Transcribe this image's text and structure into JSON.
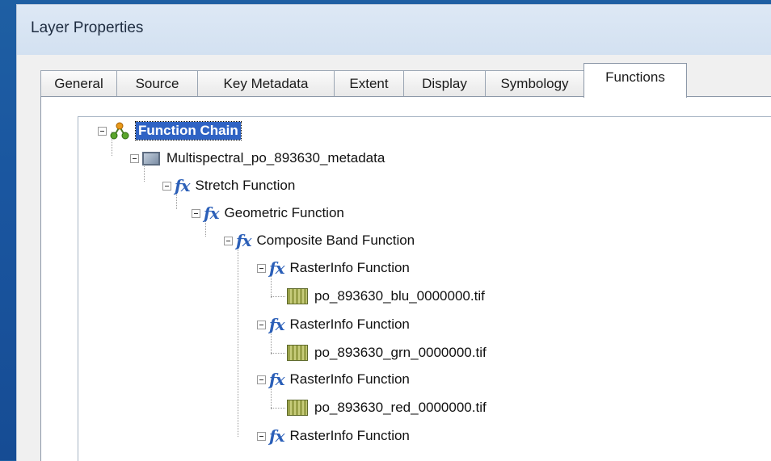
{
  "window": {
    "title": "Layer Properties"
  },
  "tabs": [
    {
      "label": "General"
    },
    {
      "label": "Source"
    },
    {
      "label": "Key Metadata"
    },
    {
      "label": "Extent"
    },
    {
      "label": "Display"
    },
    {
      "label": "Symbology"
    },
    {
      "label": "Functions"
    }
  ],
  "active_tab": "Functions",
  "tree": {
    "root": {
      "label": "Function Chain",
      "icon": "function-chain-icon"
    },
    "metadata": {
      "label": "Multispectral_po_893630_metadata",
      "icon": "raster-dataset-icon"
    },
    "stretch": {
      "label": "Stretch Function",
      "icon": "fx-icon"
    },
    "geometric": {
      "label": "Geometric Function",
      "icon": "fx-icon"
    },
    "composite": {
      "label": "Composite Band Function",
      "icon": "fx-icon"
    },
    "raster_info_1": {
      "label": "RasterInfo Function",
      "file": "po_893630_blu_0000000.tif"
    },
    "raster_info_2": {
      "label": "RasterInfo Function",
      "file": "po_893630_grn_0000000.tif"
    },
    "raster_info_3": {
      "label": "RasterInfo Function",
      "file": "po_893630_red_0000000.tif"
    },
    "raster_info_4": {
      "label": "RasterInfo Function"
    }
  },
  "colors": {
    "selection": "#2f63c4",
    "fx": "#2b5fb8",
    "background": "#1a56a0"
  }
}
